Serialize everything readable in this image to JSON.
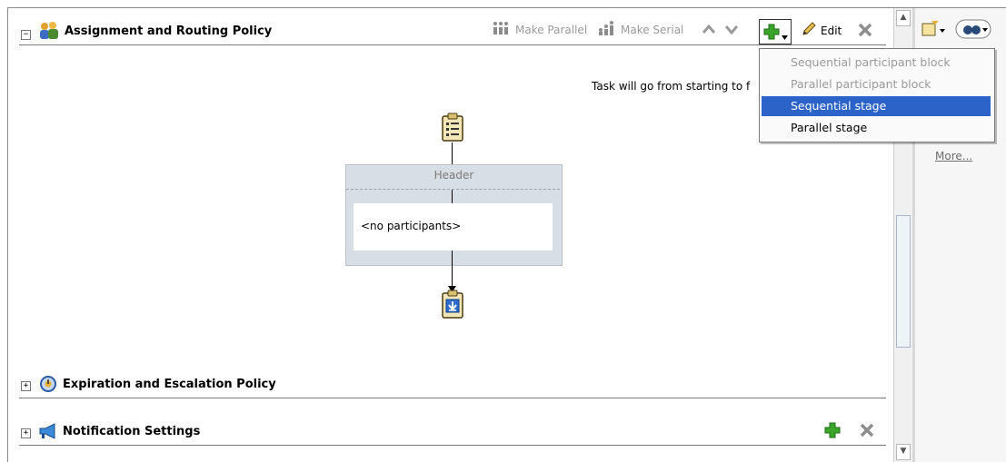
{
  "sections": {
    "assignment": {
      "title": "Assignment and Routing Policy",
      "toggle": "−"
    },
    "expiration": {
      "title": "Expiration and Escalation Policy",
      "toggle": "+"
    },
    "notification": {
      "title": "Notification Settings",
      "toggle": "+"
    }
  },
  "toolbar": {
    "make_parallel": "Make Parallel",
    "make_serial": "Make Serial",
    "edit": "Edit"
  },
  "diagram": {
    "task_text": "Task will go from starting to f",
    "header_label": "Header",
    "no_participants": "<no participants>"
  },
  "dropdown": {
    "items": [
      {
        "label": "Sequential participant block",
        "state": "disabled"
      },
      {
        "label": "Parallel participant block",
        "state": "disabled"
      },
      {
        "label": "Sequential stage",
        "state": "selected"
      },
      {
        "label": "Parallel stage",
        "state": "enabled"
      }
    ]
  },
  "right_panel": {
    "more_link": "More..."
  },
  "colors": {
    "selection": "#2b63c8",
    "add_green": "#3aa52a",
    "delete_gray": "#8e8e8e"
  }
}
